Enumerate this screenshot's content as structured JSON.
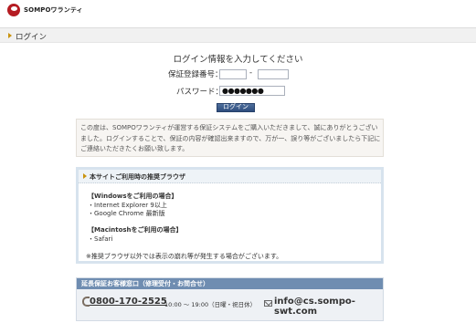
{
  "header": {
    "logo_text": "SOMPOワランティ"
  },
  "titlebar": {
    "title": "ログイン"
  },
  "login": {
    "heading": "ログイン情報を入力してください",
    "warranty_label": "保証登録番号：",
    "warranty_part1": "",
    "warranty_part2": "",
    "separator": "-",
    "password_label": "パスワード：",
    "password_value": "●●●●●●●",
    "button_label": "ログイン"
  },
  "notice": {
    "text": "この度は、SOMPOワランティが運営する保証システムをご購入いただきまして、誠にありがとうございました。ログインすることで、保証の内容が確認出来ますので、万が一、誤り等がございましたら下記にご連絡いただきたくお願い致します。"
  },
  "browser": {
    "heading": "本サイトご利用時の推奨ブラウザ",
    "windows_title": "【Windowsをご利用の場合】",
    "windows_items": [
      "・Internet Explorer 9以上",
      "・Google Chrome 最新版"
    ],
    "mac_title": "【Macintoshをご利用の場合】",
    "mac_items": [
      "・Safari"
    ],
    "note": "※推奨ブラウザ以外では表示の崩れ等が発生する場合がございます。"
  },
  "support": {
    "heading": "延長保証お客様窓口（修理受付・お問合せ）",
    "phone": "0800-170-2525",
    "hours": "10:00 ～ 19:00（日曜・祝日休）",
    "email": "info@cs.sompo-swt.com"
  },
  "colors": {
    "brand_red": "#b51c22",
    "button_blue": "#2e4d7d",
    "accent_gold": "#c9930e",
    "support_head": "#6f8db1"
  }
}
